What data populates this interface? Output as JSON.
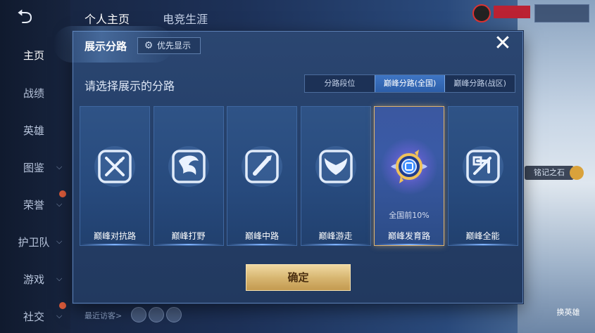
{
  "background": {
    "back_label": "⮌",
    "sidebar": [
      {
        "label": "主页",
        "active": true,
        "chevron": false,
        "dot": false
      },
      {
        "label": "战绩",
        "active": false,
        "chevron": false,
        "dot": false
      },
      {
        "label": "英雄",
        "active": false,
        "chevron": false,
        "dot": false
      },
      {
        "label": "图鉴",
        "active": false,
        "chevron": true,
        "dot": false
      },
      {
        "label": "荣誉",
        "active": false,
        "chevron": true,
        "dot": true
      },
      {
        "label": "护卫队",
        "active": false,
        "chevron": true,
        "dot": false
      },
      {
        "label": "游戏",
        "active": false,
        "chevron": true,
        "dot": false
      },
      {
        "label": "社交",
        "active": false,
        "chevron": true,
        "dot": true
      }
    ],
    "top_tabs": [
      "个人主页",
      "电竞生涯"
    ],
    "recent_visitors_label": "最近访客>",
    "right_chip": "铭记之石",
    "right_bottom": "换英雄"
  },
  "dialog": {
    "title": "展示分路",
    "priority_button": "优先显示",
    "subtitle": "请选择展示的分路",
    "segments": [
      {
        "label": "分路段位",
        "selected": false
      },
      {
        "label": "巅峰分路(全国)",
        "selected": true
      },
      {
        "label": "巅峰分路(战区)",
        "selected": false
      }
    ],
    "cards": [
      {
        "lane": "巅峰对抗路",
        "icon": "crossed-swords-icon",
        "selected": false,
        "rank": ""
      },
      {
        "lane": "巅峰打野",
        "icon": "dragon-icon",
        "selected": false,
        "rank": ""
      },
      {
        "lane": "巅峰中路",
        "icon": "staff-icon",
        "selected": false,
        "rank": ""
      },
      {
        "lane": "巅峰游走",
        "icon": "wings-icon",
        "selected": false,
        "rank": ""
      },
      {
        "lane": "巅峰发育路",
        "icon": "rank-medal-icon",
        "selected": true,
        "rank": "全国前10%"
      },
      {
        "lane": "巅峰全能",
        "icon": "all-round-icon",
        "selected": false,
        "rank": ""
      }
    ],
    "confirm_label": "确定",
    "close_symbol": "✕"
  },
  "colors": {
    "accent_gold": "#d8b772",
    "selected_segment": "#3f76c4",
    "card_border": "#3f67a0",
    "selected_card_border": "#e0b46e"
  }
}
